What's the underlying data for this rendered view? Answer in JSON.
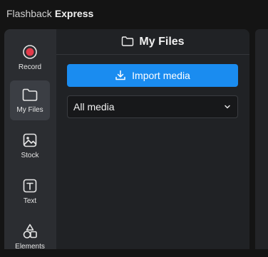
{
  "app": {
    "brand_light": "Flashback",
    "brand_bold": "Express"
  },
  "rail": {
    "items": [
      {
        "label": "Record",
        "icon": "record-icon",
        "active": false
      },
      {
        "label": "My Files",
        "icon": "folder-icon",
        "active": true
      },
      {
        "label": "Stock",
        "icon": "image-icon",
        "active": false
      },
      {
        "label": "Text",
        "icon": "text-icon",
        "active": false
      },
      {
        "label": "Elements",
        "icon": "shapes-icon",
        "active": false
      }
    ]
  },
  "panel": {
    "title": "My Files",
    "import_label": "Import media",
    "filter_value": "All media"
  },
  "colors": {
    "accent": "#1a8cf0",
    "record": "#e23b4a"
  }
}
